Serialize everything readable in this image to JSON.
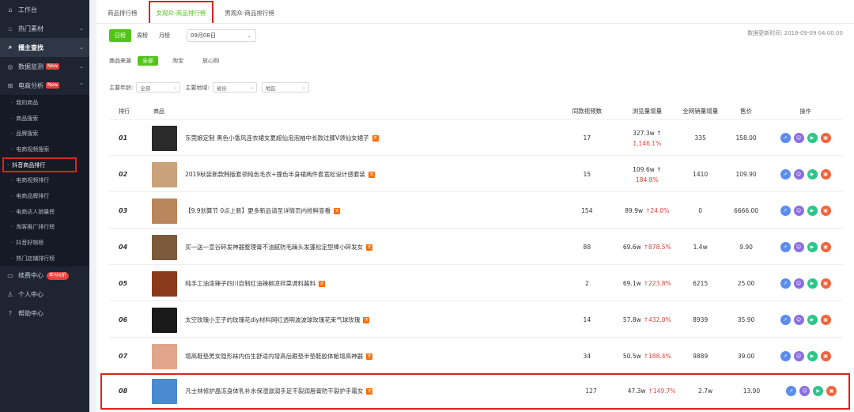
{
  "sidebar": {
    "items": [
      {
        "label": "工作台",
        "icon": "home-icon"
      },
      {
        "label": "热门素材",
        "icon": "fire-icon"
      },
      {
        "label": "播主查找",
        "icon": "search-icon"
      },
      {
        "label": "数据监测",
        "icon": "monitor-icon",
        "badge": "New"
      },
      {
        "label": "电商分析",
        "icon": "cart-icon",
        "badge": "New"
      }
    ],
    "sub_items": [
      "我的商品",
      "商品搜索",
      "品牌搜索",
      "电商视频搜索",
      "抖音商品排行",
      "电商视频排行",
      "电商品牌排行",
      "电商达人销量榜",
      "淘客推广排行榜",
      "抖音好物榜",
      "热门店铺排行榜"
    ],
    "bottom_items": [
      {
        "label": "续费中心",
        "icon": "card-icon",
        "badge": "年付6折"
      },
      {
        "label": "个人中心",
        "icon": "user-icon"
      },
      {
        "label": "帮助中心",
        "icon": "help-icon"
      }
    ]
  },
  "tabs": [
    "商品排行榜",
    "女观众-商品排行榜",
    "男观众-商品排行榜"
  ],
  "range": {
    "day": "日榜",
    "week": "周榜",
    "month": "月榜"
  },
  "date_value": "09月08日",
  "update": {
    "label": "数据更新时间:",
    "value": "2019-09-09 04:00:00"
  },
  "source": {
    "label": "商品来源",
    "options": [
      "全部",
      "淘宝",
      "放心购"
    ]
  },
  "filters": {
    "age_label": "主要年龄:",
    "age_value": "全部",
    "region_label": "主要地域:",
    "province_value": "省份",
    "district_value": "地区"
  },
  "table": {
    "headers": {
      "rank": "排行",
      "product": "商品",
      "views": "同款视频数",
      "browse": "浏览量增量",
      "sales": "全网销量增量",
      "price": "售价",
      "ops": "操作"
    },
    "rows": [
      {
        "rank": "01",
        "name": "东莞娘定制 黑色小香风连衣裙女夏超仙泡泡袖中长款过膝V领仙女裙子",
        "views": "17",
        "browse": "327.3w ↑",
        "growth": "1,146.1%",
        "sales": "335",
        "price": "158.00",
        "thumb": "#2a2a2a"
      },
      {
        "rank": "02",
        "name": "2019秋装新款韩版套领纯色毛衣+撞色半身裙两件套宽松设计感套装",
        "views": "15",
        "browse": "109.6w ↑",
        "growth": "184.8%",
        "sales": "1410",
        "price": "109.90",
        "thumb": "#c7a27a"
      },
      {
        "rank": "03",
        "name": "【9.9划算节 0点上新】更多新品请至详情页内抢鲜查看",
        "views": "154",
        "browse": "89.9w",
        "growth": "↑24.0%",
        "sales": "0",
        "price": "6666.00",
        "thumb": "#b8865a"
      },
      {
        "rank": "04",
        "name": "买一送一宣谷碎发神器整理膏不油腻防毛躁头发蓬松定型棒小碎发女",
        "views": "88",
        "browse": "69.6w",
        "growth": "↑878.5%",
        "sales": "1.4w",
        "price": "9.90",
        "thumb": "#7a5a3a"
      },
      {
        "rank": "05",
        "name": "纯手工油泼辣子四川自制红油辣椒凉拌菜调料酱料",
        "views": "2",
        "browse": "69.1w",
        "growth": "↑223.8%",
        "sales": "6215",
        "price": "25.00",
        "thumb": "#8a3a1a"
      },
      {
        "rank": "06",
        "name": "太空玫瑰小王子的玫瑰花diy材料网红透明波波球玫瑰花束气球玫瑰",
        "views": "14",
        "browse": "57.8w",
        "growth": "↑432.0%",
        "sales": "8939",
        "price": "35.90",
        "thumb": "#1a1a1a"
      },
      {
        "rank": "07",
        "name": "增高鞋垫男女隐形袜内仿生舒适内增高后跟垫半垫鞋胶体蛤增高神器",
        "views": "34",
        "browse": "50.5w",
        "growth": "↑188.4%",
        "sales": "9889",
        "price": "39.00",
        "thumb": "#e0a58a"
      },
      {
        "rank": "08",
        "name": "凡士林修护晶冻身体乳补水保湿滋润手足干裂润唇膏防干裂护手霜女",
        "views": "127",
        "browse": "47.3w",
        "growth": "↑149.7%",
        "sales": "2.7w",
        "price": "13.90",
        "thumb": "#4a8ad0"
      }
    ]
  },
  "tm_icon": "tmall-icon"
}
